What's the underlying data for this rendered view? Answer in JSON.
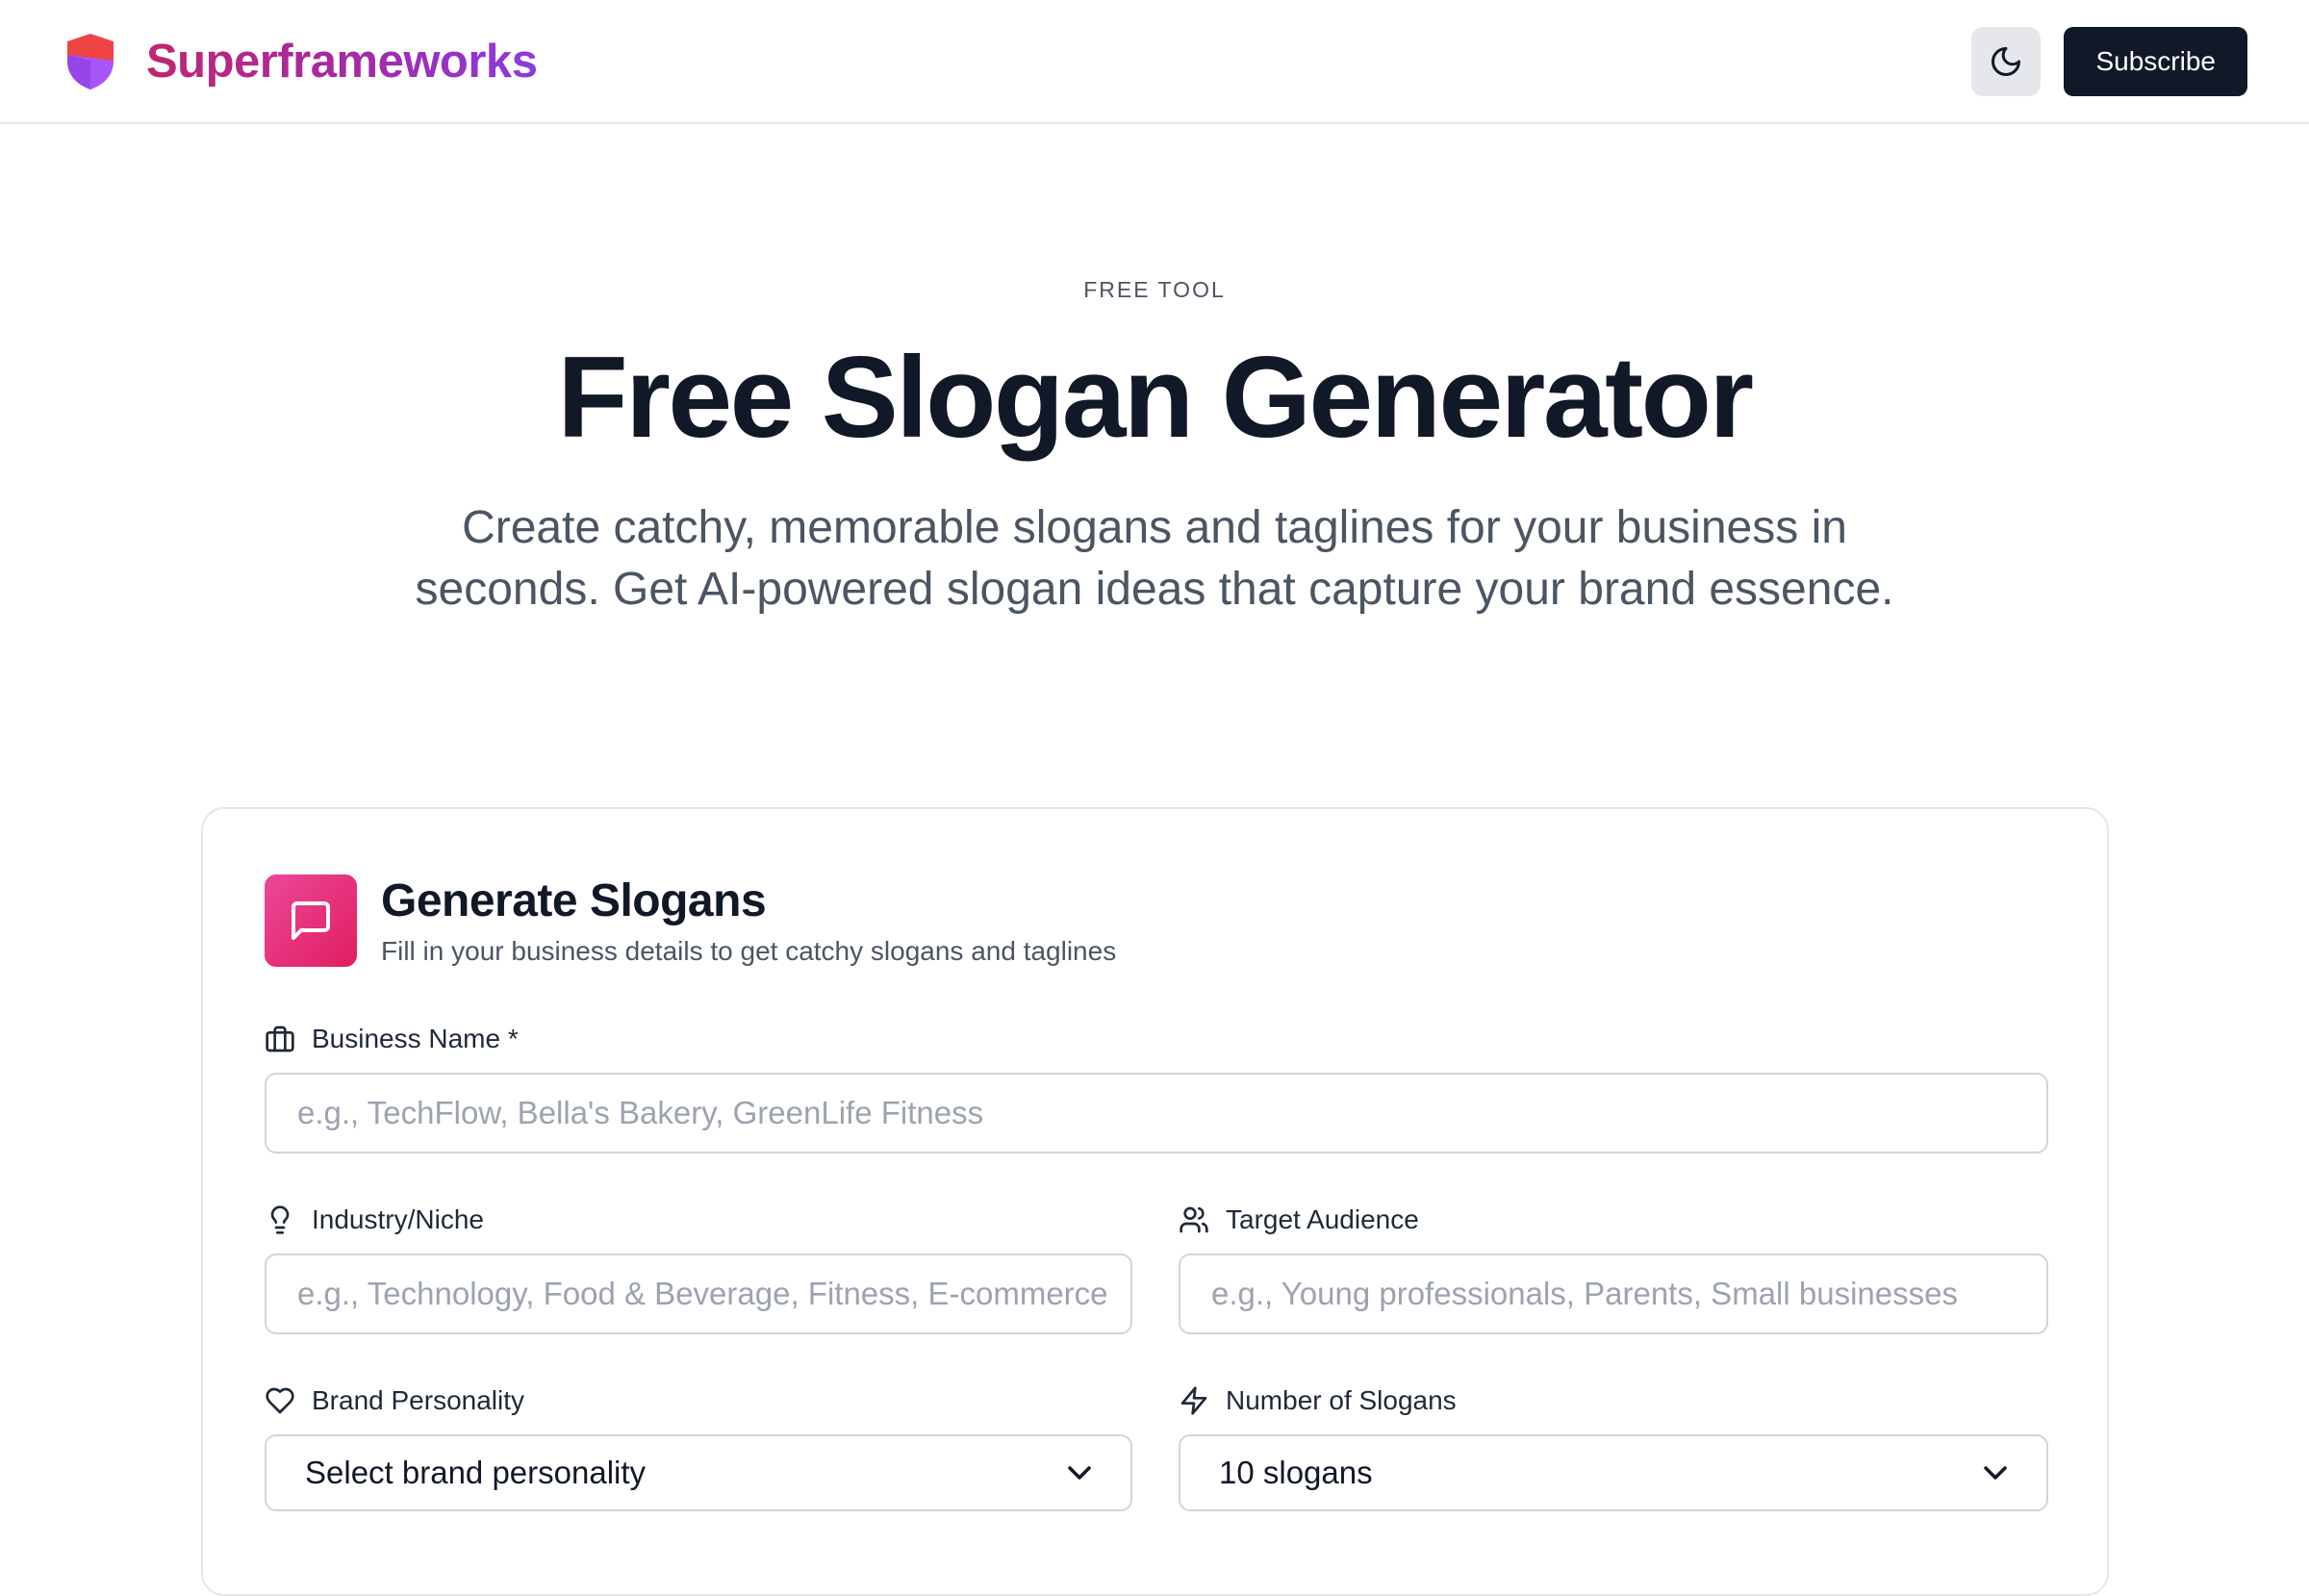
{
  "header": {
    "brand_name": "Superframeworks",
    "theme_toggle_icon": "moon-icon",
    "subscribe_label": "Subscribe"
  },
  "hero": {
    "eyebrow": "FREE TOOL",
    "title": "Free Slogan Generator",
    "subtitle": "Create catchy, memorable slogans and taglines for your business in seconds. Get AI-powered slogan ideas that capture your brand essence."
  },
  "card": {
    "icon": "message-square-icon",
    "title": "Generate Slogans",
    "description": "Fill in your business details to get catchy slogans and taglines",
    "fields": {
      "business_name": {
        "icon": "briefcase-icon",
        "label": "Business Name *",
        "placeholder": "e.g., TechFlow, Bella's Bakery, GreenLife Fitness"
      },
      "industry": {
        "icon": "lightbulb-icon",
        "label": "Industry/Niche",
        "placeholder": "e.g., Technology, Food & Beverage, Fitness, E-commerce"
      },
      "target_audience": {
        "icon": "users-icon",
        "label": "Target Audience",
        "placeholder": "e.g., Young professionals, Parents, Small businesses"
      },
      "brand_personality": {
        "icon": "heart-icon",
        "label": "Brand Personality",
        "selected": "Select brand personality"
      },
      "number_of_slogans": {
        "icon": "zap-icon",
        "label": "Number of Slogans",
        "selected": "10 slogans"
      }
    }
  },
  "colors": {
    "brand_gradient_start": "#c0266f",
    "brand_gradient_end": "#8b3be0",
    "primary_button": "#111827",
    "card_icon_bg": "#ec4899",
    "logo_shield_red": "#ef4444",
    "logo_shield_purple": "#a855f7"
  }
}
